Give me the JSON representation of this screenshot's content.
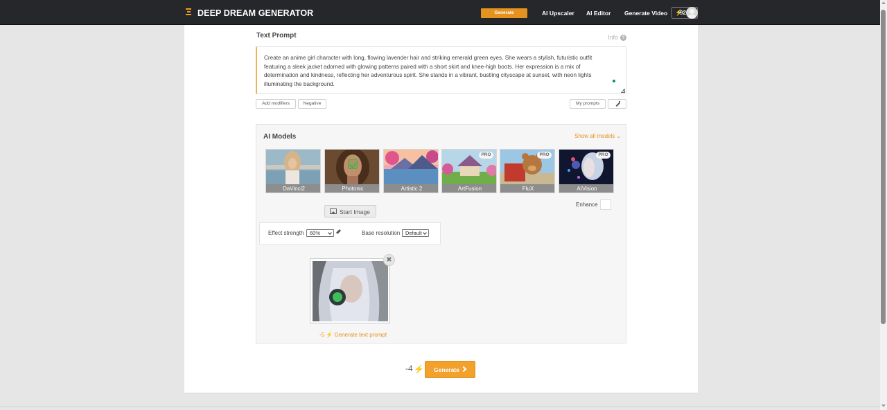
{
  "header": {
    "logo": "DEEP DREAM GENERATOR",
    "nav_generate": "Generate",
    "nav_links": [
      "AI Upscaler",
      "AI Editor",
      "Generate Video"
    ],
    "credits": "92"
  },
  "prompt": {
    "title": "Text Prompt",
    "info": "Info",
    "text": "Create an anime girl character with long, flowing lavender hair and striking emerald green eyes. She wears a stylish, futuristic outfit featuring a sleek jacket adorned with glowing patterns paired with a short skirt and knee-high boots. Her expression is a mix of determination and kindness, reflecting her adventurous spirit. She stands in a vibrant, bustling cityscape at sunset, with neon lights illuminating the background.",
    "add_modifiers": "Add modifiers",
    "negative": "Negative",
    "my_prompts": "My prompts"
  },
  "models": {
    "title": "AI Models",
    "show_all": "Show all models",
    "items": [
      {
        "label": "DaVinci2",
        "pro": "",
        "selected": false
      },
      {
        "label": "Photonic",
        "pro": "",
        "selected": true
      },
      {
        "label": "Artistic 2",
        "pro": "",
        "selected": false
      },
      {
        "label": "ArtFusion",
        "pro": "PRO",
        "selected": false
      },
      {
        "label": "FluX",
        "pro": "PRO",
        "selected": false
      },
      {
        "label": "AIVision",
        "pro": "PRO",
        "selected": false
      }
    ],
    "enhance": "Enhance",
    "start_image": "Start Image"
  },
  "settings": {
    "effect_strength_label": "Effect strength",
    "effect_strength_value": "60%",
    "base_resolution_label": "Base resolution",
    "base_resolution_value": "Default"
  },
  "start_image": {
    "generate_text_prompt": "-5 ⚡ Generate text prompt"
  },
  "footer": {
    "cost": "-4",
    "generate": "Generate"
  },
  "colors": {
    "accent": "#f1a12c",
    "topbar": "#26272b"
  }
}
